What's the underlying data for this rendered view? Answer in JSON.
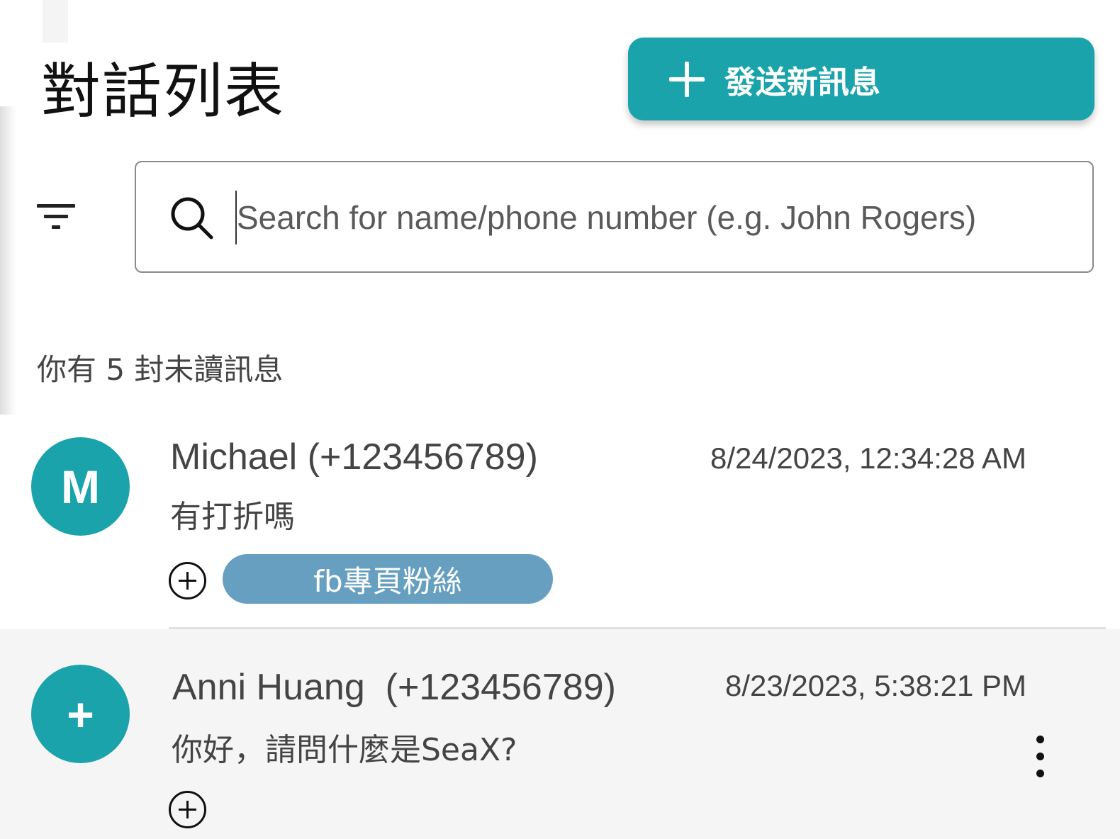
{
  "header": {
    "title": "對話列表",
    "new_message_label": "發送新訊息"
  },
  "search": {
    "placeholder": "Search for name/phone number (e.g. John Rogers)",
    "value": ""
  },
  "unread_summary": "你有 5 封未讀訊息",
  "conversations": [
    {
      "avatar": "M",
      "name": "Michael (+123456789)",
      "timestamp": "8/24/2023, 12:34:28 AM",
      "preview": "有打折嗎",
      "tags": [
        "fb專頁粉絲"
      ]
    },
    {
      "avatar": "+",
      "name": "Anni Huang  (+123456789)",
      "timestamp": "8/23/2023, 5:38:21 PM",
      "preview": "你好，請問什麼是SeaX?",
      "tags": []
    }
  ],
  "colors": {
    "accent": "#1aa3ab",
    "tag": "#679fc1",
    "selected_row": "#f5f5f5"
  },
  "icons": [
    "plus-icon",
    "filter-icon",
    "search-icon",
    "add-tag-icon",
    "more-vert-icon"
  ]
}
